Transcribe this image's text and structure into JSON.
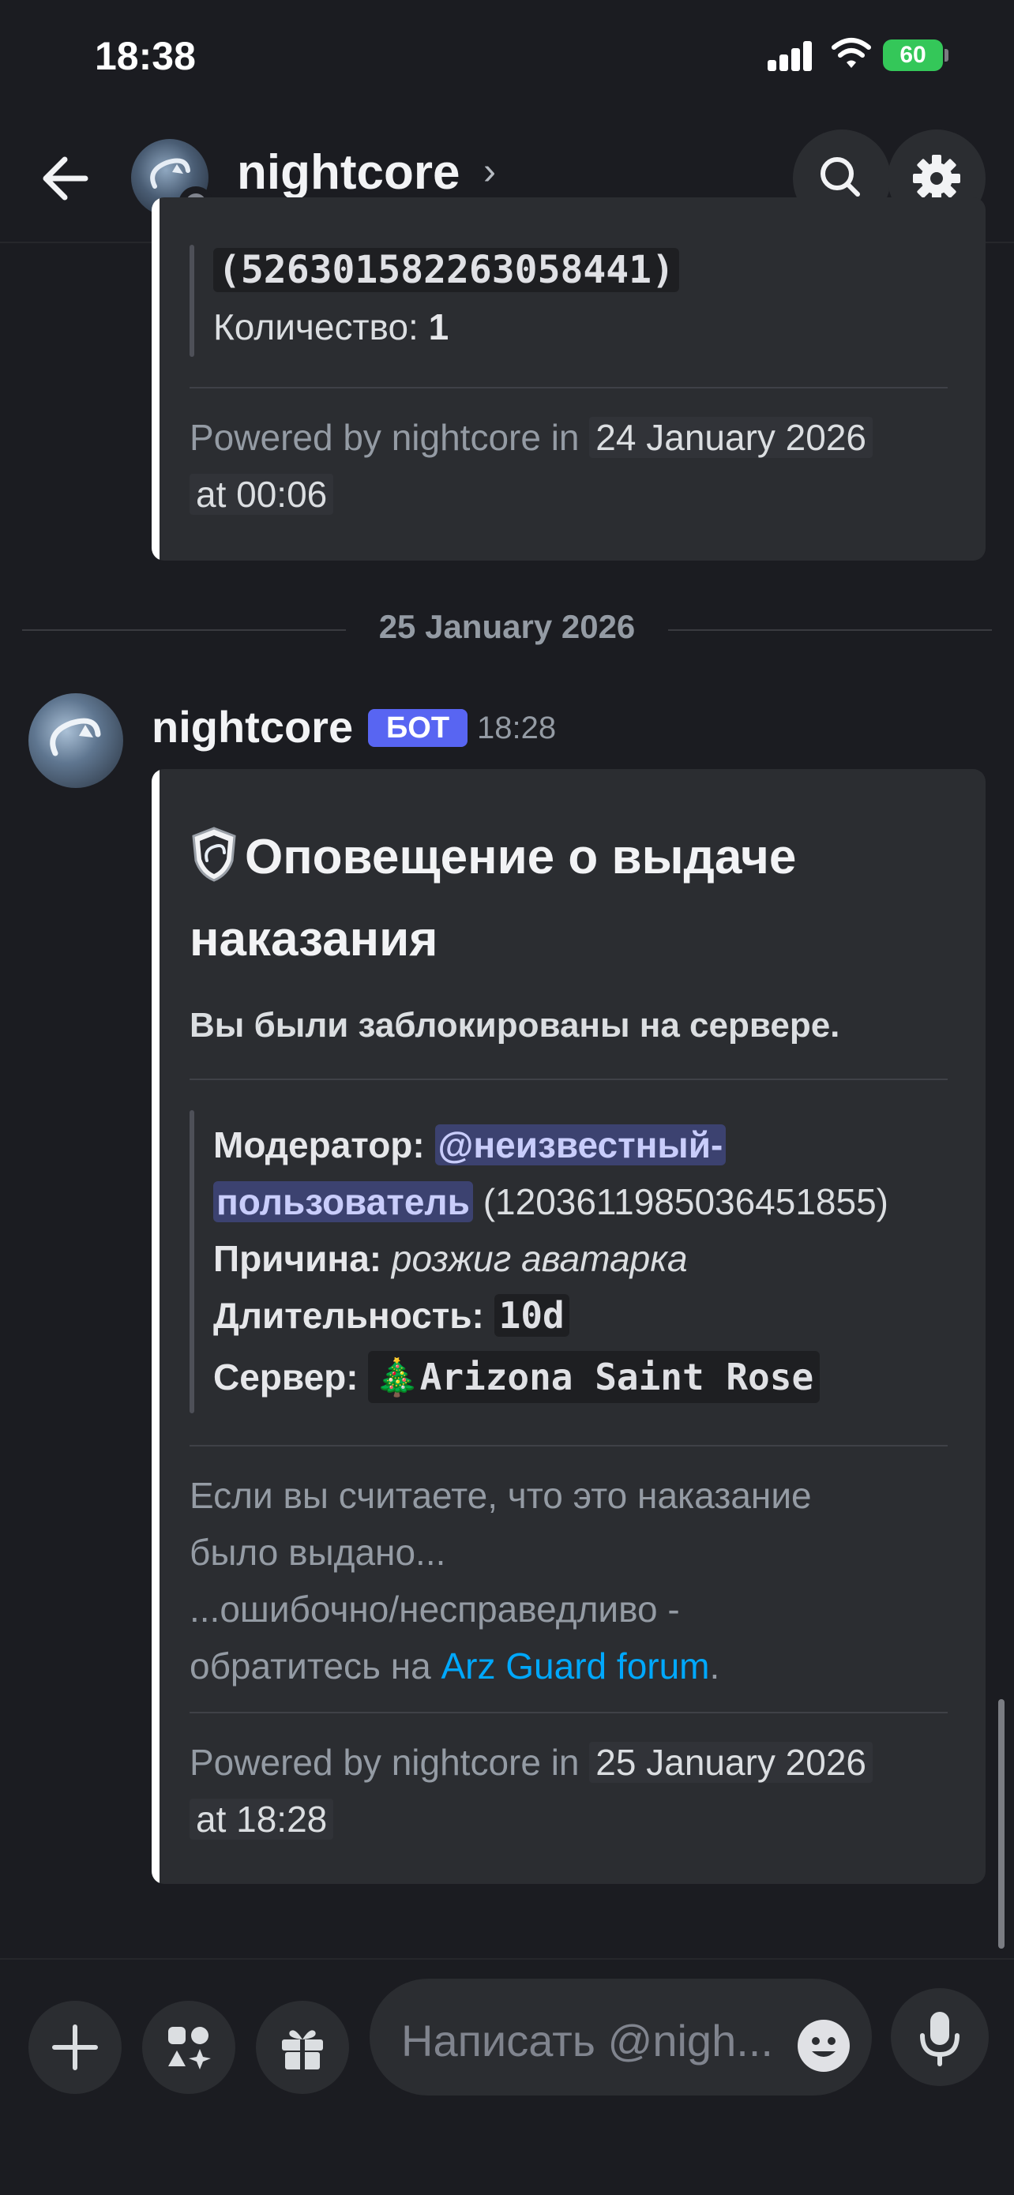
{
  "status_bar": {
    "time": "18:38",
    "battery": "60"
  },
  "header": {
    "channel_name": "nightcore",
    "chevron": "›"
  },
  "prev_embed": {
    "id_line": "(526301582263058441)",
    "quantity_label": "Количество:",
    "quantity_value": "1",
    "footer_prefix": "Powered by nightcore in",
    "footer_date_1": "24 January 2026",
    "footer_date_2": "at 00:06"
  },
  "day_separator": "25 January 2026",
  "message": {
    "author": "nightcore",
    "bot_tag": "БОТ",
    "time": "18:28",
    "embed": {
      "title_line1": "Оповещение о выдаче",
      "title_line2": "наказания",
      "description": "Вы были заблокированы на сервере.",
      "moderator_label": "Модератор:",
      "moderator_mention_1": "@неизвестный-",
      "moderator_mention_2": "пользователь",
      "moderator_id": "(1203611985036451855)",
      "reason_label": "Причина:",
      "reason_value": "розжиг аватарка",
      "duration_label": "Длительность:",
      "duration_value": "10d",
      "server_label": "Сервер:",
      "server_emoji": "🎄",
      "server_value": "Arizona Saint Rose",
      "appeal_line1": "Если вы считаете, что это наказание",
      "appeal_line2": "было выдано...",
      "appeal_line3": "...ошибочно/несправедливо -",
      "appeal_line4_prefix": "обратитесь на",
      "appeal_link": "Arz Guard forum",
      "appeal_line4_suffix": ".",
      "footer_prefix": "Powered by nightcore in",
      "footer_date_1": "25 January 2026",
      "footer_date_2": "at 18:28"
    }
  },
  "composer": {
    "placeholder": "Написать @nigh..."
  },
  "colors": {
    "accent": "#5865f2",
    "link": "#00a8fc",
    "background": "#1b1c21",
    "embed": "#2b2d31"
  }
}
